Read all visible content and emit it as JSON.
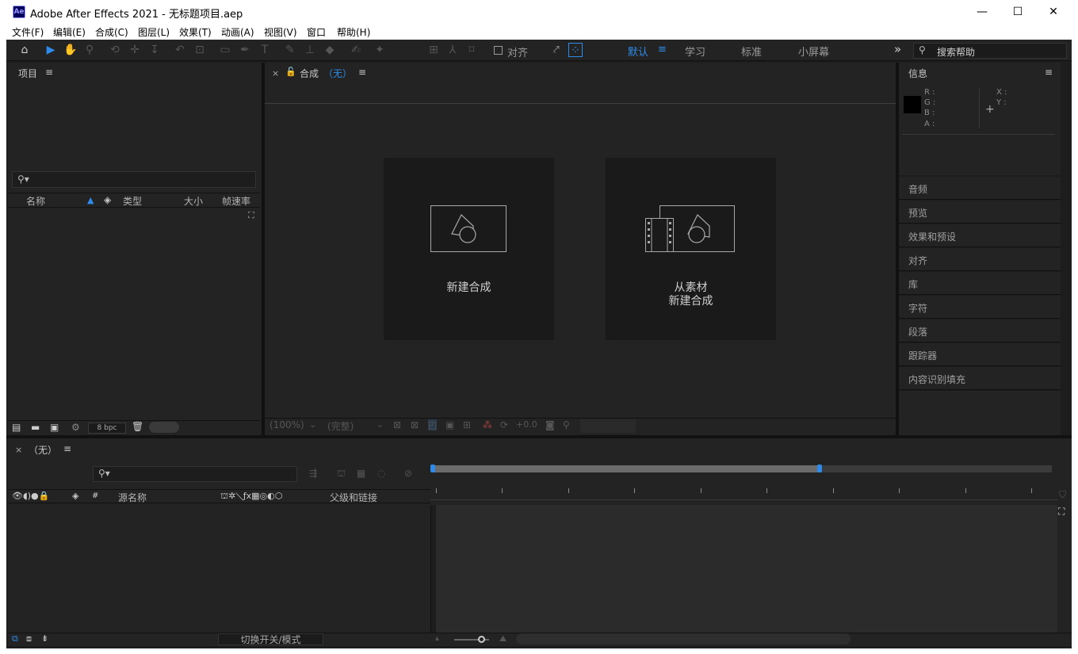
{
  "window": {
    "logo": "Ae",
    "title": "Adobe After Effects 2021 - 无标题项目.aep",
    "minimize": "—",
    "maximize": "☐",
    "close": "✕"
  },
  "menu": [
    "文件(F)",
    "编辑(E)",
    "合成(C)",
    "图层(L)",
    "效果(T)",
    "动画(A)",
    "视图(V)",
    "窗口",
    "帮助(H)"
  ],
  "toolbar": {
    "snap_label": "对齐",
    "workspaces": [
      "默认",
      "学习",
      "标准",
      "小屏幕"
    ],
    "active_workspace": "默认",
    "more": "»",
    "search_help_placeholder": "搜索帮助"
  },
  "project_panel": {
    "title": "项目",
    "columns": [
      "名称",
      "类型",
      "大小",
      "帧速率"
    ],
    "bpc": "8 bpc"
  },
  "composition_panel": {
    "close": "×",
    "title": "合成",
    "comp_name": "（无）",
    "new_comp_label": "新建合成",
    "from_footage_line1": "从素材",
    "from_footage_line2": "新建合成",
    "zoom": "(100%)",
    "resolution": "(完整)",
    "exposure": "+0.0"
  },
  "info_panel": {
    "title": "信息",
    "channels": [
      "R :",
      "G :",
      "B :",
      "A :"
    ],
    "coords": [
      "X :",
      "Y :"
    ]
  },
  "right_panels": [
    "音频",
    "预览",
    "效果和预设",
    "对齐",
    "库",
    "字符",
    "段落",
    "跟踪器",
    "内容识别填充"
  ],
  "timeline": {
    "close": "×",
    "title": "（无）",
    "columns": {
      "number": "#",
      "source_name": "源名称",
      "parent": "父级和链接"
    },
    "switch_toggle": "切换开关/模式"
  }
}
